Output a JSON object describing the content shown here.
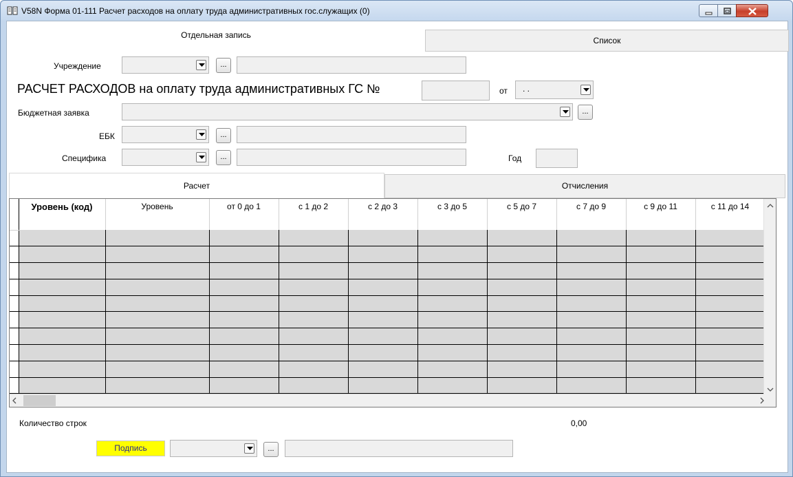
{
  "window": {
    "title": "V58N Форма 01-111 Расчет расходов на оплату труда административных гос.служащих (0)"
  },
  "top_tabs": [
    "Отдельная запись",
    "Список"
  ],
  "form": {
    "institution_label": "Учреждение",
    "heading": "РАСЧЕТ РАСХОДОВ на оплату труда административных ГС №",
    "from_label": "от",
    "date_value": ". .",
    "budget_request_label": "Бюджетная заявка",
    "ebk_label": "ЕБК",
    "specifics_label": "Специфика",
    "year_label": "Год",
    "dots": "..."
  },
  "inner_tabs": [
    "Расчет",
    "Отчисления"
  ],
  "grid": {
    "columns": [
      "Уровень (код)",
      "Уровень",
      "от 0 до 1",
      "с 1 до 2",
      "с 2 до 3",
      "с 3 до 5",
      "с 5 до 7",
      "с 7 до 9",
      "с 9 до 11",
      "с 11 до 14"
    ],
    "row_count": 10
  },
  "footer": {
    "rows_label": "Количество строк",
    "total": "0,00",
    "sign_button": "Подпись"
  },
  "colors": {
    "sign_button": "#ffff00",
    "close_button": "#c7402c"
  }
}
